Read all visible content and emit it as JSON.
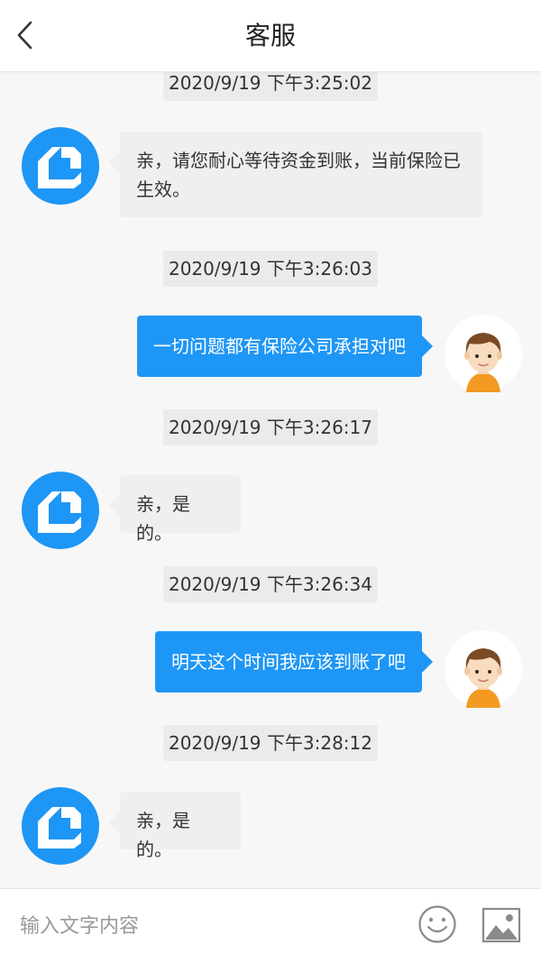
{
  "header": {
    "title": "客服",
    "back_icon": "chevron-left-icon"
  },
  "colors": {
    "accent": "#1e96f5",
    "agent_bubble": "#efefef",
    "timestamp_bg": "#ebebeb",
    "background": "#f7f7f7"
  },
  "messages": [
    {
      "timestamp": "2020/9/19 下午3:25:02",
      "sender": "agent",
      "text": "亲，请您耐心等待资金到账，当前保险已生效。"
    },
    {
      "timestamp": "2020/9/19 下午3:26:03",
      "sender": "user",
      "text": "一切问题都有保险公司承担对吧"
    },
    {
      "timestamp": "2020/9/19 下午3:26:17",
      "sender": "agent",
      "text": "亲，是的。"
    },
    {
      "timestamp": "2020/9/19 下午3:26:34",
      "sender": "user",
      "text": "明天这个时间我应该到账了吧"
    },
    {
      "timestamp": "2020/9/19 下午3:28:12",
      "sender": "agent",
      "text": "亲，是的。"
    }
  ],
  "input": {
    "placeholder": "输入文字内容",
    "value": ""
  },
  "icons": {
    "emoji": "smiley-face-icon",
    "image": "image-icon"
  }
}
